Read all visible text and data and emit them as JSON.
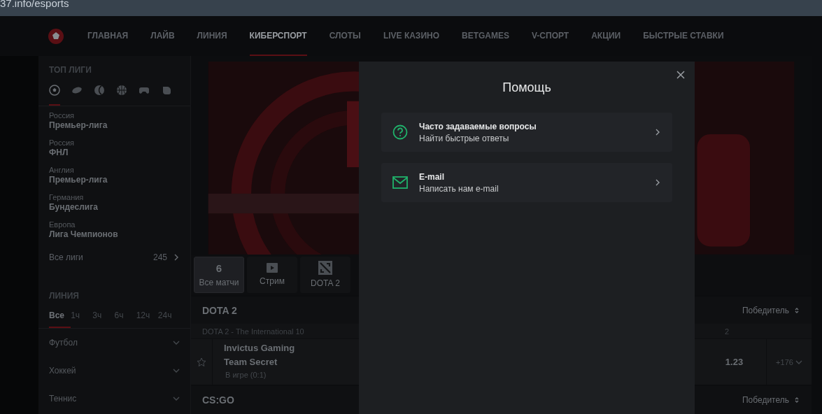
{
  "address_bar": {
    "url": "37.info/esports"
  },
  "nav": {
    "items": [
      {
        "label": "ГЛАВНАЯ",
        "selected": false
      },
      {
        "label": "ЛАЙВ",
        "selected": false
      },
      {
        "label": "ЛИНИЯ",
        "selected": false
      },
      {
        "label": "КИБЕРСПОРТ",
        "selected": true
      },
      {
        "label": "СЛОТЫ",
        "selected": false
      },
      {
        "label": "LIVE КАЗИНО",
        "selected": false
      },
      {
        "label": "BETGAMES",
        "selected": false
      },
      {
        "label": "V-СПОРТ",
        "selected": false
      },
      {
        "label": "АКЦИИ",
        "selected": false
      },
      {
        "label": "БЫСТРЫЕ СТАВКИ",
        "selected": false
      }
    ]
  },
  "sidebar": {
    "top_leagues": {
      "title": "ТОП ЛИГИ",
      "sport_tabs": [
        {
          "kind": "football",
          "selected": true
        },
        {
          "kind": "hockey",
          "selected": false
        },
        {
          "kind": "tennis",
          "selected": false
        },
        {
          "kind": "basketball",
          "selected": false
        },
        {
          "kind": "gamepad",
          "selected": false
        },
        {
          "kind": "boxing",
          "selected": false
        }
      ],
      "leagues": [
        {
          "country": "Россия",
          "name": "Премьер-лига"
        },
        {
          "country": "Россия",
          "name": "ФНЛ"
        },
        {
          "country": "Англия",
          "name": "Премьер-лига"
        },
        {
          "country": "Германия",
          "name": "Бундеслига"
        },
        {
          "country": "Европа",
          "name": "Лига Чемпионов"
        }
      ],
      "all_leagues": {
        "label": "Все лиги",
        "count": "245"
      }
    },
    "line": {
      "title": "ЛИНИЯ",
      "time_filters": [
        {
          "label": "Все",
          "selected": true
        },
        {
          "label": "1ч",
          "selected": false
        },
        {
          "label": "3ч",
          "selected": false
        },
        {
          "label": "6ч",
          "selected": false
        },
        {
          "label": "12ч",
          "selected": false
        },
        {
          "label": "24ч",
          "selected": false
        }
      ],
      "sports": [
        {
          "name": "Футбол"
        },
        {
          "name": "Хоккей"
        },
        {
          "name": "Теннис"
        }
      ]
    }
  },
  "main": {
    "filter_tabs": [
      {
        "kind": "count",
        "value": "6",
        "label": "Все матчи",
        "selected": true
      },
      {
        "kind": "stream",
        "label": "Стрим",
        "selected": false
      },
      {
        "kind": "game",
        "label": "DOTA 2",
        "selected": false
      }
    ],
    "sections": [
      {
        "title": "DOTA 2",
        "market": "Победитель",
        "tournament": "DOTA 2 - The International 10",
        "column": "2",
        "matches": [
          {
            "team1": "Invictus Gaming",
            "team2": "Team Secret",
            "status": "В игре (0:1)",
            "odd": "1.23",
            "more": "+176"
          }
        ]
      },
      {
        "title": "CS:GO",
        "market": "Победитель"
      }
    ]
  },
  "modal": {
    "title": "Помощь",
    "items": [
      {
        "kind": "faq",
        "title": "Часто задаваемые вопросы",
        "subtitle": "Найти быстрые ответы"
      },
      {
        "kind": "email",
        "title": "E-mail",
        "subtitle": "Написать нам e-mail"
      }
    ]
  }
}
